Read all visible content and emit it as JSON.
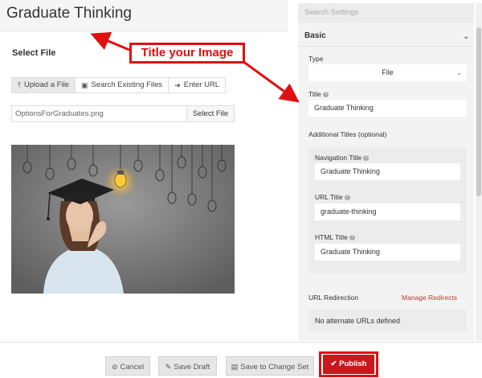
{
  "page": {
    "title": "Graduate Thinking"
  },
  "left": {
    "section_label": "Select File",
    "tabs": [
      {
        "label": "Upload a File",
        "icon": "upload-icon"
      },
      {
        "label": "Search Existing Files",
        "icon": "image-icon"
      },
      {
        "label": "Enter URL",
        "icon": "arrow-right-icon"
      }
    ],
    "file_name": "OptionsForGraduates.png",
    "select_file_label": "Select File",
    "image_alt": "Graduate Thinking"
  },
  "settings": {
    "search_placeholder": "Search Settings",
    "group_label": "Basic",
    "type_label": "Type",
    "type_value": "File",
    "title_label": "Title",
    "title_value": "Graduate Thinking",
    "additional_titles_label": "Additional Titles (optional)",
    "nav_title_label": "Navigation Title",
    "nav_title_value": "Graduate Thinking",
    "url_title_label": "URL Title",
    "url_title_value": "graduate-thinking",
    "html_title_label": "HTML Title",
    "html_title_value": "Graduate Thinking",
    "url_redirection_label": "URL Redirection",
    "manage_redirects_label": "Manage Redirects",
    "no_urls_text": "No alternate URLs defined"
  },
  "footer": {
    "cancel_label": "Cancel",
    "save_draft_label": "Save Draft",
    "save_to_change_set_label": "Save to Change Set",
    "publish_label": "Publish"
  },
  "annotation": {
    "callout_text": "Title your Image"
  },
  "colors": {
    "accent_red": "#c9181e",
    "annotation_red": "#e01010",
    "link_red": "#c0392b"
  }
}
